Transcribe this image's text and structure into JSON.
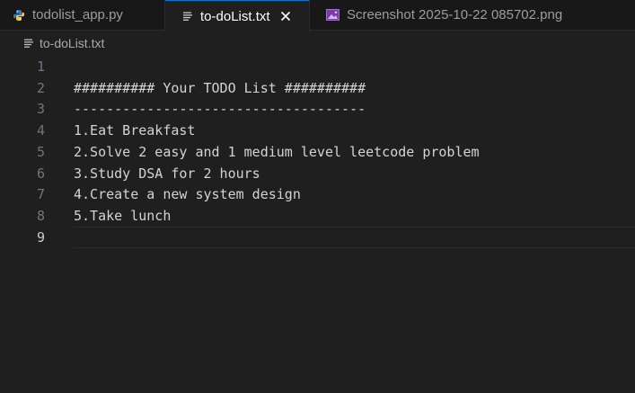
{
  "tabs": [
    {
      "label": "todolist_app.py",
      "icon": "python-icon",
      "active": false
    },
    {
      "label": "to-doList.txt",
      "icon": "text-file-icon",
      "active": true,
      "close_icon": "close-icon"
    },
    {
      "label": "Screenshot 2025-10-22 085702.png",
      "icon": "image-file-icon",
      "active": false
    }
  ],
  "breadcrumb": {
    "label": "to-doList.txt",
    "icon": "text-file-icon"
  },
  "editor": {
    "line_numbers": [
      "1",
      "2",
      "3",
      "4",
      "5",
      "6",
      "7",
      "8",
      "9"
    ],
    "current_line": "9",
    "lines": [
      "",
      "########## Your TODO List ##########",
      "------------------------------------",
      "1.Eat Breakfast",
      "2.Solve 2 easy and 1 medium level leetcode problem",
      "3.Study DSA for 2 hours",
      "4.Create a new system design",
      "5.Take lunch",
      ""
    ]
  },
  "colors": {
    "background": "#1f1f1f",
    "tab_bar": "#181818",
    "active_tab_accent": "#0078d4",
    "text": "#d4d4d4",
    "line_number": "#6e7681"
  }
}
